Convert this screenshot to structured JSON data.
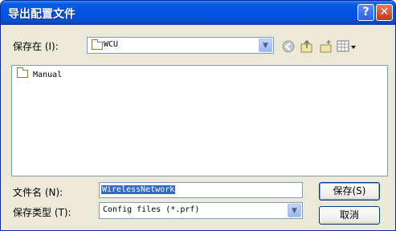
{
  "window": {
    "title": "导出配置文件"
  },
  "title_buttons": {
    "help": "?",
    "close": "✕"
  },
  "save_in": {
    "label": "保存在 (I):",
    "value": "WCU"
  },
  "toolbar": {
    "back_icon": "back-icon",
    "up_icon": "up-folder-icon",
    "new_folder_icon": "new-folder-icon",
    "views_icon": "views-menu-icon"
  },
  "file_list": {
    "items": [
      "Manual"
    ]
  },
  "filename": {
    "label": "文件名 (N):",
    "value": "WirelessNetwork"
  },
  "filetype": {
    "label": "保存类型 (T):",
    "value": "Config files (*.prf)"
  },
  "buttons": {
    "save": "保存(S)",
    "cancel": "取消"
  }
}
